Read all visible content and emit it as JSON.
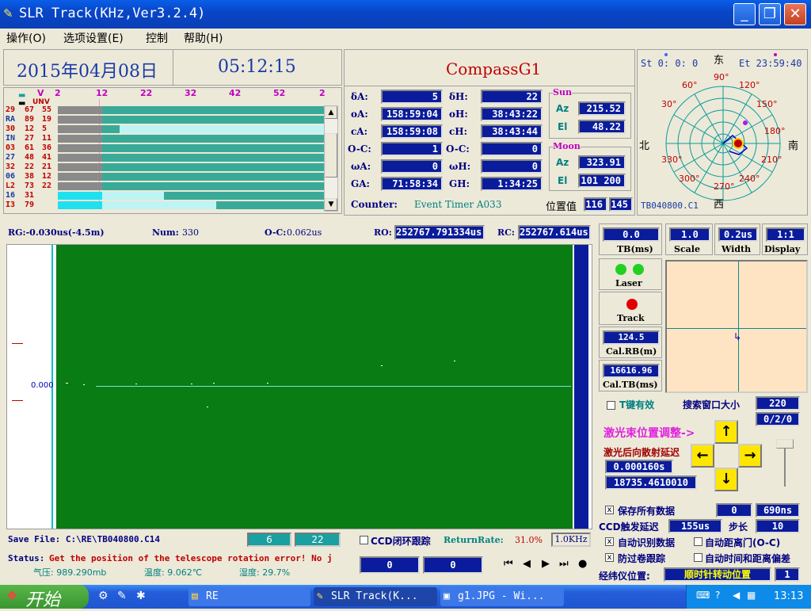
{
  "window": {
    "title": "SLR Track(KHz,Ver3.2.4)",
    "minimize": "_",
    "maximize": "❐",
    "close": "✕"
  },
  "menu": [
    {
      "label": "操作(O)"
    },
    {
      "label": "选项设置(E)"
    },
    {
      "label": "控制"
    },
    {
      "label": "帮助(H)"
    }
  ],
  "header": {
    "date": "2015年04月08日",
    "time": "05:12:15",
    "satellite": "CompassG1"
  },
  "passlist": {
    "legend_v": "V",
    "legend_unv": "UNV",
    "hours": [
      "2",
      "12",
      "22",
      "32",
      "42",
      "52",
      "2"
    ],
    "rows": [
      {
        "name": "29",
        "a": "67",
        "b": "55"
      },
      {
        "name": "RA",
        "a": "89",
        "b": "19"
      },
      {
        "name": "30",
        "a": "12",
        "b": "5"
      },
      {
        "name": "IN",
        "a": "27",
        "b": "11"
      },
      {
        "name": "03",
        "a": "61",
        "b": "36"
      },
      {
        "name": "27",
        "a": "48",
        "b": "41"
      },
      {
        "name": "32",
        "a": "22",
        "b": "21"
      },
      {
        "name": "06",
        "a": "38",
        "b": "12"
      },
      {
        "name": "L2",
        "a": "73",
        "b": "22"
      },
      {
        "name": "16",
        "a": "31",
        "b": ""
      },
      {
        "name": "I3",
        "a": "79",
        "b": ""
      }
    ]
  },
  "track": {
    "dA_label": "δA:",
    "dA": "5",
    "dH_label": "δH:",
    "dH": "22",
    "oA_label": "oA:",
    "oA": "158:59:04",
    "oH_label": "oH:",
    "oH": "38:43:22",
    "cA_label": "cA:",
    "cA": "158:59:08",
    "cH_label": "cH:",
    "cH": "38:43:44",
    "oc1_label": "O-C:",
    "oc1": "1",
    "oc2_label": "O-C:",
    "oc2": "0",
    "wA_label": "ωA:",
    "wA": "0",
    "wH_label": "ωH:",
    "wH": "0",
    "GA_label": "GA:",
    "GA": "71:58:34",
    "GH_label": "GH:",
    "GH": "1:34:25",
    "counter_label": "Counter:",
    "counter_value": "Event Timer A033",
    "pos_label": "位置值",
    "pos1": "116",
    "pos2": "145"
  },
  "sun": {
    "title": "Sun",
    "az_label": "Az",
    "az": "215.52",
    "el_label": "El",
    "el": "48.22"
  },
  "moon": {
    "title": "Moon",
    "az_label": "Az",
    "az": "323.91",
    "el_label": "El",
    "el": "101 200"
  },
  "polar": {
    "st": "St  0: 0: 0",
    "et": "Et 23:59:40",
    "east": "东",
    "west": "西",
    "north": "北",
    "south": "南",
    "angles": [
      "90°",
      "120°",
      "150°",
      "180°",
      "210°",
      "240°",
      "270°",
      "300°",
      "330°",
      "30°",
      "60°"
    ],
    "file": "TB040800.C1"
  },
  "plot": {
    "rg": "RG:-0.030us(-4.5m)",
    "num_label": "Num:",
    "num": "330",
    "oc_label": "O-C:",
    "oc": "0.062us",
    "ro_label": "RO:",
    "ro": "252767.791334us",
    "rc_label": "RC:",
    "rc": "252767.614us",
    "zero_label": "0.000"
  },
  "rightpanel": {
    "tb_value": "0.0",
    "tb_label": "TB(ms)",
    "scale_value": "1.0",
    "scale_label": "Scale",
    "width_value": "0.2us",
    "width_label": "Width",
    "display_value": "1:1",
    "display_label": "Display",
    "laser_label": "Laser",
    "track_label": "Track",
    "calrb_value": "124.5",
    "calrb_label": "Cal.RB(m)",
    "caltb_value": "16616.96",
    "caltb_label": "Cal.TB(ms)"
  },
  "controls": {
    "tkey_label": "T键有效",
    "search_label": "搜索窗口大小",
    "search_value": "220",
    "search_value2": "0/2/0",
    "beam_adjust": "激光束位置调整->",
    "backscatter": "激光后向散射延迟",
    "delay1": "0.000160s",
    "delay2": "18735.4610010",
    "save_all": "保存所有数据",
    "save_all_v1": "0",
    "save_all_v2": "690ns",
    "ccd_delay_label": "CCD触发延迟",
    "ccd_delay": "155us",
    "step_label": "步长",
    "step": "10",
    "auto_id": "自动识别数据",
    "auto_gate": "自动距离门(O-C)",
    "anti_wind": "防过卷跟踪",
    "auto_time": "自动时间和距离偏差",
    "theo_label": "经纬仪位置:",
    "theo_value": "顺时针转动位置",
    "theo_num": "1"
  },
  "bottom": {
    "save_file": "Save File: C:\\RE\\TB040800.C14",
    "save_v1": "6",
    "save_v2": "22",
    "ccd_loop": "CCD闭环跟踪",
    "return_label": "ReturnRate:",
    "return_value": "31.0%",
    "khz": "1.0KHz",
    "status_label": "Status:",
    "status_msg": "Get the position of the telescope rotation error! No j",
    "pressure": "气压: 989.290mb",
    "temp": "温度: 9.062℃",
    "humidity": "湿度: 29.7%",
    "status_v1": "0",
    "status_v2": "0"
  },
  "taskbar": {
    "start": "开始",
    "tasks": [
      {
        "label": "RE"
      },
      {
        "label": "SLR Track(K..."
      },
      {
        "label": "g1.JPG - Wi..."
      }
    ],
    "clock": "13:13"
  },
  "colors": {
    "plot_bg": "#0a7c14",
    "lcd_bg": "#0a1c9c",
    "title_blue": "#0a5ee8"
  }
}
